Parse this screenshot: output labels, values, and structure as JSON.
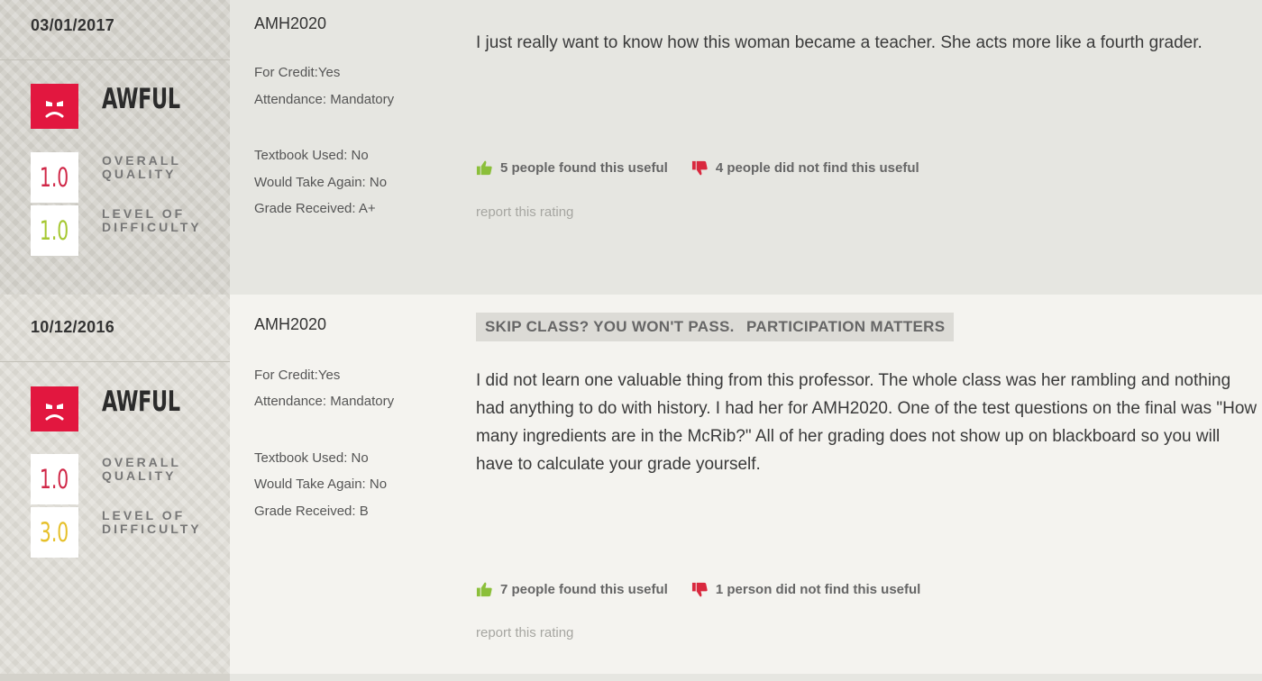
{
  "ratings": [
    {
      "date": "03/01/2017",
      "quality_word": "AWFUL",
      "overall_quality_score": "1.0",
      "overall_quality_label": "OVERALL QUALITY",
      "difficulty_score": "1.0",
      "difficulty_label": "LEVEL OF DIFFICULTY",
      "class_name": "AMH2020",
      "for_credit": "For Credit:Yes",
      "attendance": "Attendance: Mandatory",
      "textbook": "Textbook Used: No",
      "take_again": "Would Take Again: No",
      "grade": "Grade Received: A+",
      "comment": "I just really want to know how this woman became a teacher. She acts more like a fourth grader.",
      "useful": "5 people found this useful",
      "not_useful": "4 people did not find this useful",
      "report": "report this rating",
      "score_colors": {
        "quality": "#d02848",
        "difficulty": "#a6c832"
      }
    },
    {
      "date": "10/12/2016",
      "quality_word": "AWFUL",
      "overall_quality_score": "1.0",
      "overall_quality_label": "OVERALL QUALITY",
      "difficulty_score": "3.0",
      "difficulty_label": "LEVEL OF DIFFICULTY",
      "class_name": "AMH2020",
      "for_credit": "For Credit:Yes",
      "attendance": "Attendance: Mandatory",
      "textbook": "Textbook Used: No",
      "take_again": "Would Take Again: No",
      "grade": "Grade Received: B",
      "tags": [
        "SKIP CLASS? YOU WON'T PASS.",
        "PARTICIPATION MATTERS"
      ],
      "comment": "I did not learn one valuable thing from this professor. The whole class was her rambling and nothing had anything to do with history. I had her for AMH2020. One of the test questions on the final was \"How many ingredients are in the McRib?\" All of her grading does not show up on blackboard so you will have to calculate your grade yourself.",
      "useful": "7 people found this useful",
      "not_useful": "1 person did not find this useful",
      "report": "report this rating",
      "score_colors": {
        "quality": "#d02848",
        "difficulty": "#e6c02a"
      }
    }
  ],
  "icons": {
    "face": "awful-face-icon",
    "thumbs_up": "thumbs-up-icon",
    "thumbs_down": "thumbs-down-icon"
  },
  "colors": {
    "awful_red": "#e2173f",
    "thumbs_up_green": "#8bbf3a",
    "thumbs_down_red": "#d9283e"
  }
}
